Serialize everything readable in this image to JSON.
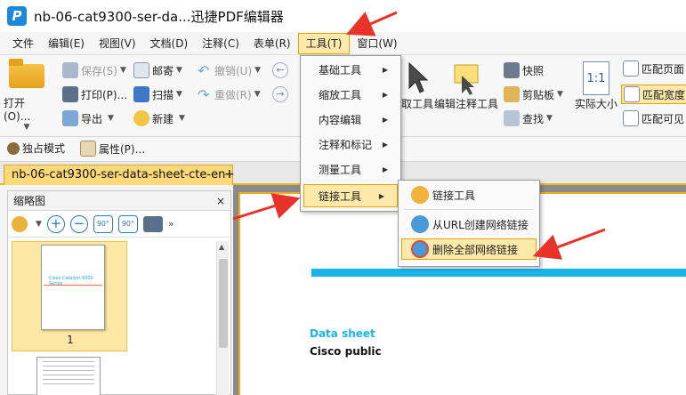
{
  "titlebar": {
    "logo_letter": "P",
    "title": "nb-06-cat9300-ser-da...迅捷PDF编辑器"
  },
  "menubar": {
    "items": [
      "文件",
      "编辑(E)",
      "视图(V)",
      "文档(D)",
      "注释(C)",
      "表单(R)",
      "工具(T)",
      "窗口(W)"
    ],
    "active_index": 6
  },
  "ribbon": {
    "open_label": "打开(O)...",
    "save_label": "保存(S)",
    "print_label": "打印(P)...",
    "export_label": "导出",
    "email_label": "邮寄",
    "scan_label": "扫描",
    "new_label": "新建",
    "undo_label": "撤销(U)",
    "redo_label": "重做(R)",
    "select_tool_label": "取工具",
    "edit_annot_label": "编辑注释工具",
    "snapshot_label": "快照",
    "clipboard_label": "剪贴板",
    "find_label": "查找",
    "actual_size_label": "实际大小",
    "actual_size_icon_text": "1:1",
    "fit_page_label": "匹配页面",
    "fit_width_label": "匹配宽度",
    "fit_visible_label": "匹配可见"
  },
  "moderow": {
    "exclusive_label": "独占模式",
    "properties_label": "属性(P)..."
  },
  "tabs": {
    "doc_tab_label": "nb-06-cat9300-ser-data-sheet-cte-en",
    "add_symbol": "+"
  },
  "leftpanel": {
    "title": "缩略图",
    "close_symbol": "×",
    "rotate_left_text": "90°",
    "rotate_right_text": "90°",
    "thumb_title": "Cisco Catalyst 9300 Series",
    "page_number": "1"
  },
  "document": {
    "label": "Data sheet",
    "sublabel": "Cisco public"
  },
  "dropdown": {
    "items": [
      "基础工具",
      "缩放工具",
      "内容编辑",
      "注释和标记",
      "测量工具",
      "链接工具"
    ],
    "highlight_index": 5
  },
  "submenu": {
    "items": [
      "链接工具",
      "从URL创建网络链接",
      "删除全部网络链接"
    ],
    "highlight_index": 2
  },
  "colors": {
    "accent": "#f0b622",
    "highlight": "#fde9a9",
    "annotation_arrow": "#e8332a",
    "doc_band": "#1ab5e8"
  }
}
